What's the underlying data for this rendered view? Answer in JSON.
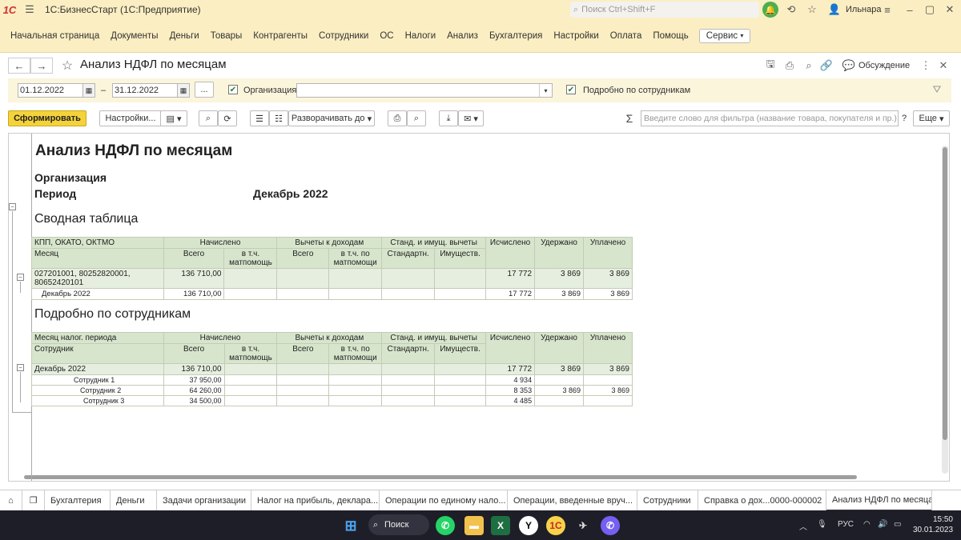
{
  "app": {
    "logo": "1С",
    "title": "1С:БизнесСтарт  (1С:Предприятие)",
    "search_placeholder": "Поиск Ctrl+Shift+F",
    "user_initial": "И",
    "user_name": "Ильнара"
  },
  "menu": [
    "Начальная страница",
    "Документы",
    "Деньги",
    "Товары",
    "Контрагенты",
    "Сотрудники",
    "ОС",
    "Налоги",
    "Анализ",
    "Бухгалтерия",
    "Настройки",
    "Оплата",
    "Помощь"
  ],
  "service_label": "Сервис",
  "doc": {
    "title": "Анализ НДФЛ по месяцам",
    "discuss_label": "Обсуждение"
  },
  "filter": {
    "date_from": "01.12.2022",
    "dash": "–",
    "date_to": "31.12.2022",
    "period_btn": "...",
    "org_label": "Организация:",
    "org_value": "",
    "detail_label": "Подробно по сотрудникам"
  },
  "toolbar": {
    "generate": "Сформировать",
    "settings": "Настройки...",
    "expand": "Разворачивать до",
    "filter_placeholder": "Введите слово для фильтра (название товара, покупателя и пр.)",
    "help": "?",
    "more": "Еще"
  },
  "report": {
    "title": "Анализ НДФЛ по месяцам",
    "org_label": "Организация",
    "period_label": "Период",
    "period_value": "Декабрь 2022",
    "summary_title": "Сводная таблица",
    "detail_title": "Подробно по сотрудникам",
    "summary": {
      "h1": [
        "КПП, ОКАТО, ОКТМО",
        "Начислено",
        "Вычеты к доходам",
        "Станд. и имущ. вычеты",
        "Исчислено",
        "Удержано",
        "Уплачено"
      ],
      "h2": [
        "Месяц",
        "Всего",
        "в т.ч. матпомощь",
        "Всего",
        "в т.ч. по матпомощи",
        "Стандартн.",
        "Имуществ."
      ],
      "group": {
        "name": "027201001, 80252820001, 80652420101",
        "total": "136 710,00",
        "calc": "17 772",
        "held": "3 869",
        "paid": "3 869"
      },
      "rows": [
        {
          "name": "Декабрь 2022",
          "total": "136 710,00",
          "calc": "17 772",
          "held": "3 869",
          "paid": "3 869"
        }
      ]
    },
    "detail": {
      "h1": [
        "Месяц налог. периода",
        "Начислено",
        "Вычеты к доходам",
        "Станд. и имущ. вычеты",
        "Исчислено",
        "Удержано",
        "Уплачено"
      ],
      "h2": [
        "Сотрудник",
        "Всего",
        "в т.ч. матпомощь",
        "Всего",
        "в т.ч. по матпомощи",
        "Стандартн.",
        "Имуществ."
      ],
      "group": {
        "name": "Декабрь 2022",
        "total": "136 710,00",
        "calc": "17 772",
        "held": "3 869",
        "paid": "3 869"
      },
      "rows": [
        {
          "name": "Сотрудник 1",
          "total": "37 950,00",
          "calc": "4 934",
          "held": "",
          "paid": ""
        },
        {
          "name": "Сотрудник 2",
          "total": "64 260,00",
          "calc": "8 353",
          "held": "3 869",
          "paid": "3 869"
        },
        {
          "name": "Сотрудник 3",
          "total": "34 500,00",
          "calc": "4 485",
          "held": "",
          "paid": ""
        }
      ]
    }
  },
  "tabs": [
    "Бухгалтерия",
    "Деньги",
    "Задачи организации",
    "Налог на прибыль, деклара...",
    "Операции по единому нало...",
    "Операции, введенные вруч...",
    "Сотрудники",
    "Справка о дох...0000-000002",
    "Анализ НДФЛ по месяцам"
  ],
  "taskbar": {
    "search_label": "Поиск",
    "lang": "РУС",
    "time": "15:50",
    "date": "30.01.2023"
  }
}
